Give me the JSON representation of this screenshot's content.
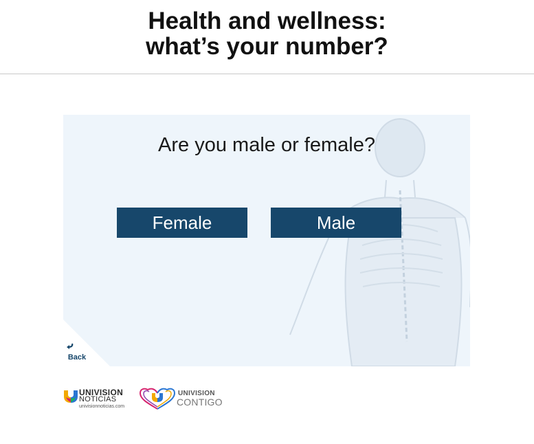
{
  "header": {
    "title_line1": "Health and wellness:",
    "title_line2": "what’s your number?"
  },
  "quiz": {
    "question": "Are you male or female?",
    "options": [
      {
        "label": "Female"
      },
      {
        "label": "Male"
      }
    ],
    "back_label": "Back"
  },
  "footer": {
    "noticias": {
      "brand": "UNIVISION",
      "product": "NOTICIAS",
      "url": "univisionnoticias.com"
    },
    "contigo": {
      "brand": "UNIVISION",
      "product": "CONTIGO"
    }
  },
  "colors": {
    "button_bg": "#17476b",
    "stage_bg": "#eef5fb"
  }
}
